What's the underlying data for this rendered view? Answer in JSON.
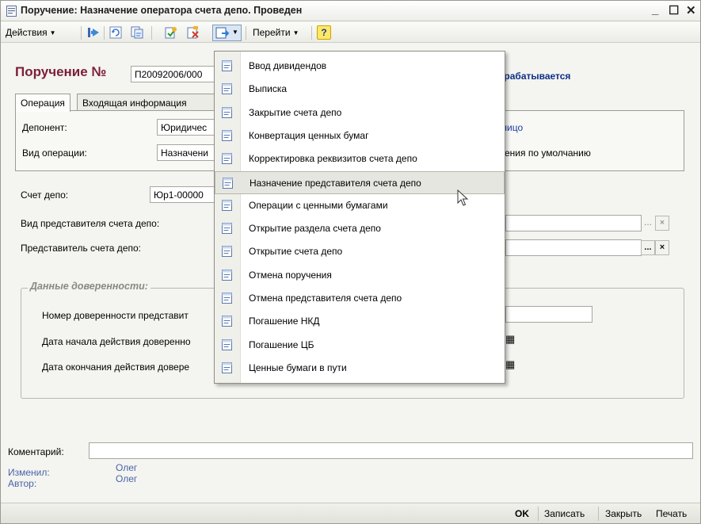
{
  "window": {
    "title": "Поручение: Назначение оператора счета депо. Проведен",
    "controls": {
      "minimize": "_",
      "maximize": "☐",
      "close": "✕"
    }
  },
  "toolbar": {
    "actions_label": "Действия",
    "goto_label": "Перейти",
    "help_label": "?",
    "dropdown_arrow": "▼"
  },
  "document": {
    "heading": "Поручение №",
    "number": "П20092006/000",
    "status_partial": "брабатывается"
  },
  "tabs": [
    {
      "label": "Операция",
      "active": true
    },
    {
      "label": "Входящая информация",
      "active": false
    }
  ],
  "operation_tab": {
    "depositor_label": "Депонент:",
    "depositor_value": "Юридичес",
    "depositor_link_partial": "лицо",
    "op_type_label": "Вид операции:",
    "op_type_value": "Назначени",
    "op_type_extra_partial": "ения по умолчанию"
  },
  "form": {
    "account_label": "Счет депо:",
    "account_value": "Юр1-00000",
    "rep_type_label": "Вид представителя счета депо:",
    "rep_label": "Представитель счета депо:",
    "choose_btn": "...",
    "clear_btn": "×"
  },
  "power_of_attorney": {
    "group_title": "Данные доверенности:",
    "number_label": "Номер доверенности представит",
    "start_label": "Дата начала действия доверенно",
    "end_label": "Дата окончания действия довере",
    "calendar_icon": "▦"
  },
  "menu": {
    "items": [
      {
        "label": "Ввод дивидендов",
        "hover": false
      },
      {
        "label": "Выписка",
        "hover": false
      },
      {
        "label": "Закрытие счета депо",
        "hover": false
      },
      {
        "label": "Конвертация ценных бумаг",
        "hover": false
      },
      {
        "label": "Корректировка реквизитов счета депо",
        "hover": false
      },
      {
        "label": "Назначение представителя счета депо",
        "hover": true
      },
      {
        "label": "Операции с ценными бумагами",
        "hover": false
      },
      {
        "label": "Открытие раздела счета депо",
        "hover": false
      },
      {
        "label": "Открытие счета депо",
        "hover": false
      },
      {
        "label": "Отмена поручения",
        "hover": false
      },
      {
        "label": "Отмена представителя счета депо",
        "hover": false
      },
      {
        "label": "Погашение НКД",
        "hover": false
      },
      {
        "label": "Погашение ЦБ",
        "hover": false
      },
      {
        "label": "Ценные бумаги в пути",
        "hover": false
      }
    ]
  },
  "footer_info": {
    "comment_label": "Коментарий:",
    "comment_value": "",
    "changed_label": "Изменил:",
    "changed_value": "Олег",
    "author_label": "Автор:",
    "author_value": "Олег"
  },
  "bottom_buttons": {
    "ok": "OK",
    "save": "Записать",
    "close": "Закрыть",
    "print": "Печать"
  },
  "colors": {
    "doc_title": "#7b1f3a",
    "status": "#0c2e88",
    "link": "#1a3fa6",
    "background": "#f4f4f0"
  }
}
